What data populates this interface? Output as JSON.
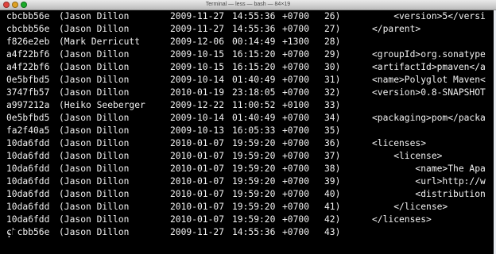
{
  "window": {
    "title": "Terminal — less — bash — 84×19"
  },
  "lines": [
    {
      "hash": "cbcbb56e",
      "author": "(Jason Dillon",
      "date": "2009-11-27",
      "time": "14:55:36",
      "tz": "+0700",
      "num": "26)",
      "code": "    <version>5</versi"
    },
    {
      "hash": "cbcbb56e",
      "author": "(Jason Dillon",
      "date": "2009-11-27",
      "time": "14:55:36",
      "tz": "+0700",
      "num": "27)",
      "code": "</parent>"
    },
    {
      "hash": "f826e2eb",
      "author": "(Mark Derricutt",
      "date": "2009-12-06",
      "time": "00:14:49",
      "tz": "+1300",
      "num": "28)",
      "code": ""
    },
    {
      "hash": "a4f22bf6",
      "author": "(Jason Dillon",
      "date": "2009-10-15",
      "time": "16:15:20",
      "tz": "+0700",
      "num": "29)",
      "code": "<groupId>org.sonatype"
    },
    {
      "hash": "a4f22bf6",
      "author": "(Jason Dillon",
      "date": "2009-10-15",
      "time": "16:15:20",
      "tz": "+0700",
      "num": "30)",
      "code": "<artifactId>pmaven</a"
    },
    {
      "hash": "0e5bfbd5",
      "author": "(Jason Dillon",
      "date": "2009-10-14",
      "time": "01:40:49",
      "tz": "+0700",
      "num": "31)",
      "code": "<name>Polyglot Maven<"
    },
    {
      "hash": "3747fb57",
      "author": "(Jason Dillon",
      "date": "2010-01-19",
      "time": "23:18:05",
      "tz": "+0700",
      "num": "32)",
      "code": "<version>0.8-SNAPSHOT"
    },
    {
      "hash": "a997212a",
      "author": "(Heiko Seeberger",
      "date": "2009-12-22",
      "time": "11:00:52",
      "tz": "+0100",
      "num": "33)",
      "code": ""
    },
    {
      "hash": "0e5bfbd5",
      "author": "(Jason Dillon",
      "date": "2009-10-14",
      "time": "01:40:49",
      "tz": "+0700",
      "num": "34)",
      "code": "<packaging>pom</packa"
    },
    {
      "hash": "fa2f40a5",
      "author": "(Jason Dillon",
      "date": "2009-10-13",
      "time": "16:05:33",
      "tz": "+0700",
      "num": "35)",
      "code": ""
    },
    {
      "hash": "10da6fdd",
      "author": "(Jason Dillon",
      "date": "2010-01-07",
      "time": "19:59:20",
      "tz": "+0700",
      "num": "36)",
      "code": "<licenses>"
    },
    {
      "hash": "10da6fdd",
      "author": "(Jason Dillon",
      "date": "2010-01-07",
      "time": "19:59:20",
      "tz": "+0700",
      "num": "37)",
      "code": "    <license>"
    },
    {
      "hash": "10da6fdd",
      "author": "(Jason Dillon",
      "date": "2010-01-07",
      "time": "19:59:20",
      "tz": "+0700",
      "num": "38)",
      "code": "        <name>The Apa"
    },
    {
      "hash": "10da6fdd",
      "author": "(Jason Dillon",
      "date": "2010-01-07",
      "time": "19:59:20",
      "tz": "+0700",
      "num": "39)",
      "code": "        <url>http://w"
    },
    {
      "hash": "10da6fdd",
      "author": "(Jason Dillon",
      "date": "2010-01-07",
      "time": "19:59:20",
      "tz": "+0700",
      "num": "40)",
      "code": "        <distribution"
    },
    {
      "hash": "10da6fdd",
      "author": "(Jason Dillon",
      "date": "2010-01-07",
      "time": "19:59:20",
      "tz": "+0700",
      "num": "41)",
      "code": "    </license>"
    },
    {
      "hash": "10da6fdd",
      "author": "(Jason Dillon",
      "date": "2010-01-07",
      "time": "19:59:20",
      "tz": "+0700",
      "num": "42)",
      "code": "</licenses>"
    },
    {
      "hash": "cbcbb56e",
      "author": "(Jason Dillon",
      "date": "2009-11-27",
      "time": "14:55:36",
      "tz": "+0700",
      "num": "43)",
      "code": ""
    }
  ],
  "prompt": ":",
  "colors": {
    "background": "#000000",
    "text": "#f2f2f2"
  }
}
